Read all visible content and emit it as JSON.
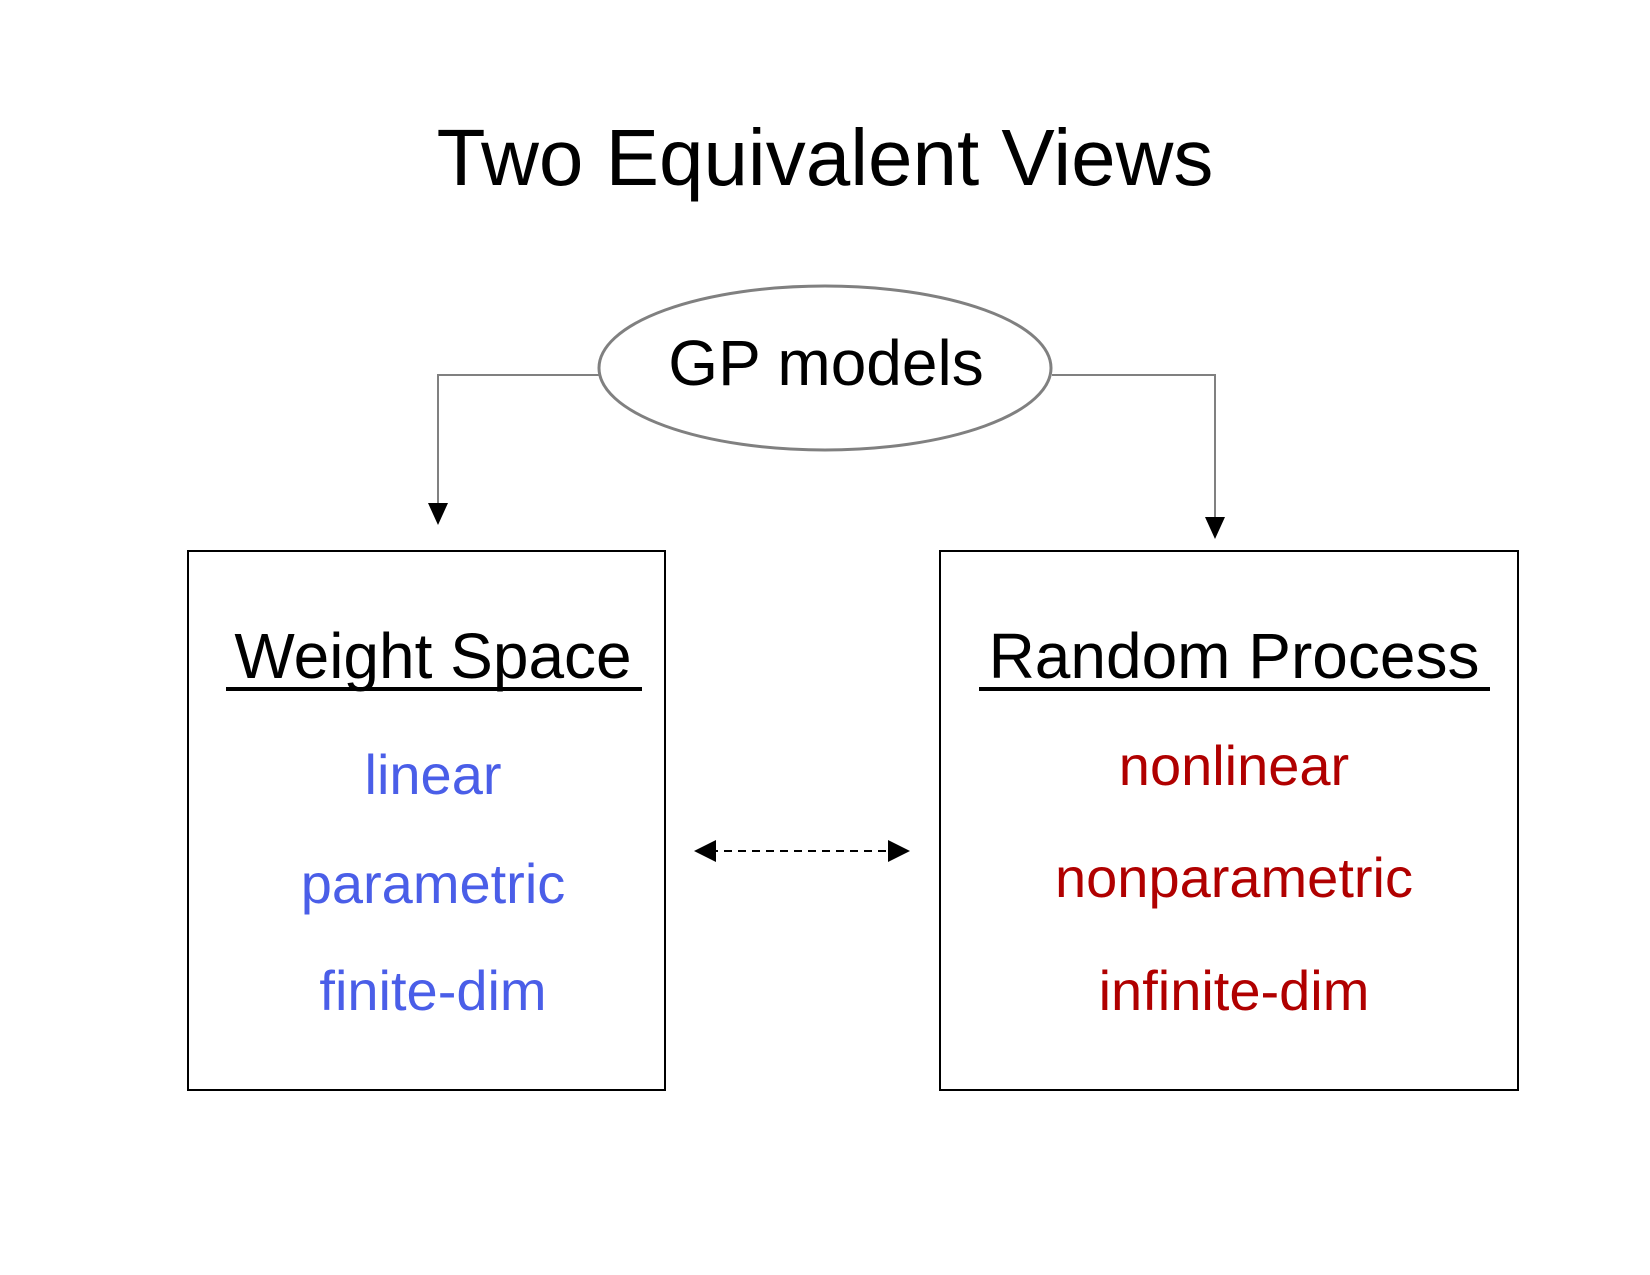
{
  "title": "Two Equivalent Views",
  "root_node": {
    "label": "GP models"
  },
  "left_box": {
    "heading": "Weight Space",
    "color": "#4a5ee8",
    "items": [
      "linear",
      "parametric",
      "finite-dim"
    ]
  },
  "right_box": {
    "heading": "Random Process",
    "color": "#b00000",
    "items": [
      "nonlinear",
      "nonparametric",
      "infinite-dim"
    ]
  },
  "colors": {
    "ellipse_stroke": "#808080",
    "connector_stroke": "#808080",
    "arrow": "#000000",
    "box_stroke": "#000000",
    "text": "#000000"
  }
}
